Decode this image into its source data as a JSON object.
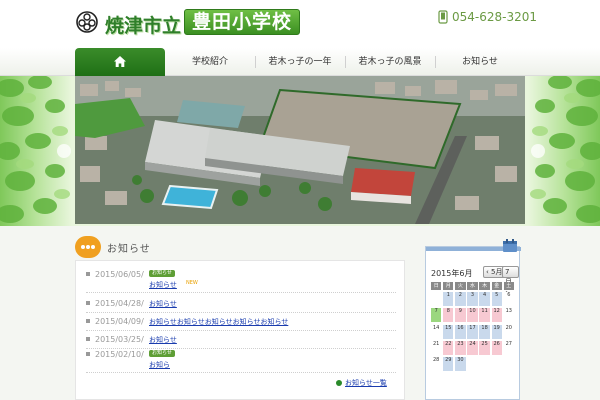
{
  "header": {
    "school_city": "焼津市立",
    "school_name": "豊田小学校",
    "phone": "054-628-3201"
  },
  "nav": {
    "items": [
      {
        "label": "学校紹介"
      },
      {
        "label": "若木っ子の一年"
      },
      {
        "label": "若木っ子の風景"
      },
      {
        "label": "お知らせ"
      }
    ]
  },
  "news": {
    "title": "お知らせ",
    "items": [
      {
        "date": "2015/06/05/",
        "tag": "お知らせ",
        "title": "お知らせ",
        "new": "NEW"
      },
      {
        "date": "2015/04/28/",
        "tag": "",
        "title": "お知らせ"
      },
      {
        "date": "2015/04/09/",
        "tag": "",
        "title": "お知らせお知らせお知らせお知らせお知らせ"
      },
      {
        "date": "2015/03/25/",
        "tag": "",
        "title": "お知らせ"
      },
      {
        "date": "2015/02/10/",
        "tag": "お知らせ",
        "title": "お知ら"
      }
    ],
    "more_label": "お知らせ一覧"
  },
  "calendar": {
    "month_label": "2015年6月",
    "prev_label": "‹ 5月",
    "next_label": "7月 ›",
    "weekdays": [
      "日",
      "月",
      "火",
      "水",
      "木",
      "金",
      "土"
    ],
    "weeks": [
      [
        "",
        "1",
        "2",
        "3",
        "4",
        "5",
        "6"
      ],
      [
        "7",
        "8",
        "9",
        "10",
        "11",
        "12",
        "13"
      ],
      [
        "14",
        "15",
        "16",
        "17",
        "18",
        "19",
        "20"
      ],
      [
        "21",
        "22",
        "23",
        "24",
        "25",
        "26",
        "27"
      ],
      [
        "28",
        "29",
        "30",
        "",
        "",
        "",
        ""
      ]
    ],
    "colors": {
      "header": "#8a8a8a",
      "weekday": "#c9d9ec",
      "holiday": "#f7c9d2",
      "today": "#9bd77f"
    }
  },
  "colors": {
    "brand_green": "#3b8f22",
    "link": "#1a3cae",
    "accent_orange": "#f0a020"
  }
}
